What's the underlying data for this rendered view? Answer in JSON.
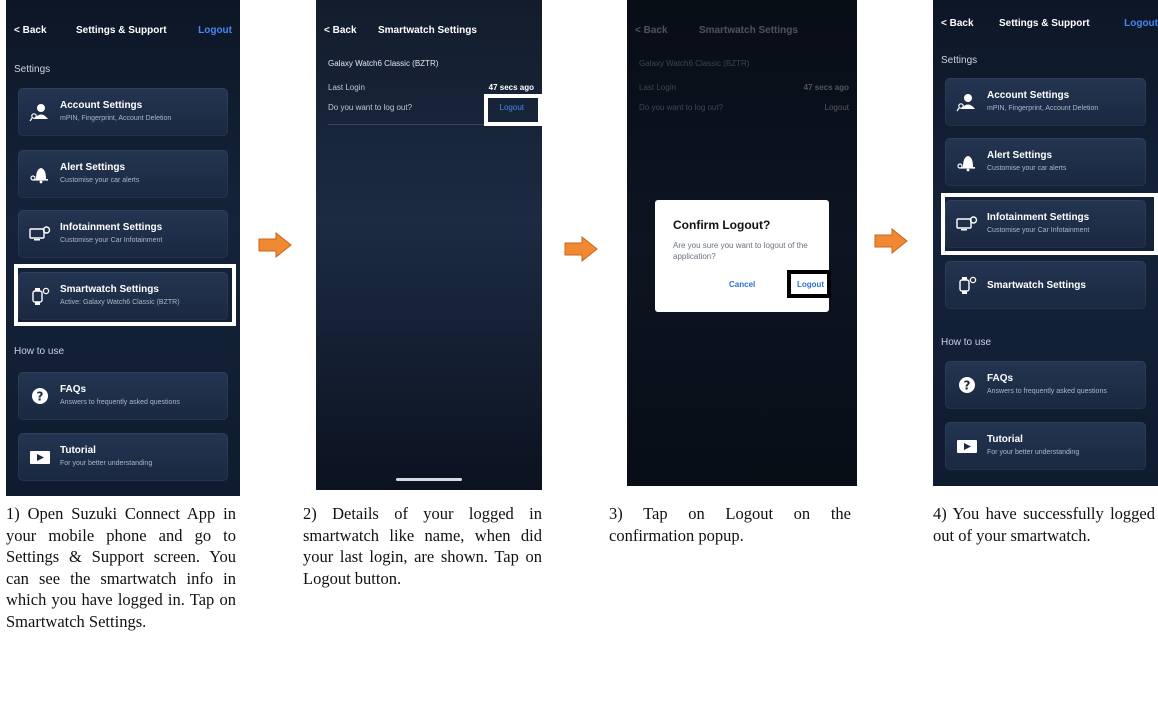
{
  "colors": {
    "accent_blue": "#4a86f0",
    "arrow_orange": "#f08a32",
    "highlight_white": "#ffffff",
    "highlight_black": "#000000"
  },
  "screen1": {
    "back": "< Back",
    "title": "Settings & Support",
    "logout": "Logout",
    "settings_header": "Settings",
    "cards": [
      {
        "title": "Account Settings",
        "subtitle": "mPIN, Fingerprint, Account Deletion",
        "icon": "user-key-icon"
      },
      {
        "title": "Alert Settings",
        "subtitle": "Customise your car alerts",
        "icon": "bell-key-icon"
      },
      {
        "title": "Infotainment Settings",
        "subtitle": "Customise your Car Infotainment",
        "icon": "monitor-gear-icon"
      },
      {
        "title": "Smartwatch Settings",
        "subtitle": "Active: Galaxy Watch6 Classic (BZTR)",
        "icon": "watch-gear-icon"
      }
    ],
    "howto_header": "How to use",
    "howto_cards": [
      {
        "title": "FAQs",
        "subtitle": "Answers to frequently asked questions",
        "icon": "question-icon"
      },
      {
        "title": "Tutorial",
        "subtitle": "For your better understanding",
        "icon": "play-icon"
      }
    ]
  },
  "screen2": {
    "back": "< Back",
    "title": "Smartwatch Settings",
    "device": "Galaxy Watch6 Classic (BZTR)",
    "last_login_label": "Last Login",
    "last_login_value": "47 secs ago",
    "logout_question": "Do you want to log out?",
    "logout_link": "Logout"
  },
  "screen3": {
    "dialog_title": "Confirm Logout?",
    "dialog_message": "Are you sure you want to logout of the application?",
    "cancel": "Cancel",
    "logout": "Logout"
  },
  "screen4": {
    "back": "< Back",
    "title": "Settings & Support",
    "logout": "Logout",
    "settings_header": "Settings",
    "cards": [
      {
        "title": "Account Settings",
        "subtitle": "mPIN, Fingerprint, Account Deletion"
      },
      {
        "title": "Alert Settings",
        "subtitle": "Customise your car alerts"
      },
      {
        "title": "Infotainment Settings",
        "subtitle": "Customise your Car Infotainment"
      },
      {
        "title": "Smartwatch Settings"
      }
    ],
    "howto_header": "How to use",
    "howto_cards": [
      {
        "title": "FAQs",
        "subtitle": "Answers to frequently asked questions"
      },
      {
        "title": "Tutorial",
        "subtitle": "For your better understanding"
      }
    ]
  },
  "captions": [
    "1) Open Suzuki Connect App in your mobile phone and go to Settings & Support screen. You can see the smartwatch info in which you have logged in. Tap on Smartwatch Settings.",
    "2) Details of your logged in smartwatch like name, when did your last login, are shown. Tap on Logout button.",
    "3) Tap on Logout on the confirmation popup.",
    "4) You have successfully logged out of your smartwatch."
  ]
}
